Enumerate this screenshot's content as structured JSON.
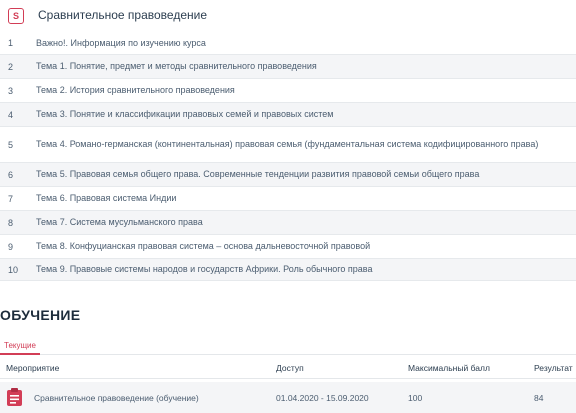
{
  "course": {
    "icon": "document-s-icon",
    "icon_letter": "S",
    "title": "Сравнительное правоведение"
  },
  "topics": [
    {
      "num": "1",
      "label": "Важно!. Информация по изучению курса"
    },
    {
      "num": "2",
      "label": "Тема 1. Понятие, предмет и методы сравнительного правоведения"
    },
    {
      "num": "3",
      "label": "Тема 2. История сравнительного правоведения"
    },
    {
      "num": "4",
      "label": "Тема 3. Понятие и классификации правовых семей и правовых систем"
    },
    {
      "num": "5",
      "label": "Тема 4. Романо-германская (континентальная) правовая семья (фундаментальная система кодифицированного права)"
    },
    {
      "num": "6",
      "label": "Тема 5. Правовая семья общего права. Современные тенденции развития правовой семьи общего права"
    },
    {
      "num": "7",
      "label": "Тема 6. Правовая система Индии"
    },
    {
      "num": "8",
      "label": "Тема 7. Система мусульманского права"
    },
    {
      "num": "9",
      "label": "Тема 8. Конфуцианская правовая система – основа дальневосточной правовой"
    },
    {
      "num": "10",
      "label": "Тема 9. Правовые системы народов и государств Африки. Роль обычного права"
    }
  ],
  "section": {
    "title": "ОБУЧЕНИЕ",
    "tab_current": "Текущие"
  },
  "events_table": {
    "columns": [
      "Мероприятие",
      "Доступ",
      "Максимальный балл",
      "Результат"
    ],
    "rows": [
      {
        "icon": "clipboard-icon",
        "name": "Сравнительное правоведение (обучение)",
        "access": "01.04.2020 - 15.09.2020",
        "max_score": "100",
        "result": "84"
      }
    ]
  },
  "colors": {
    "accent": "#d23d56",
    "row_alt": "#f4f5f7",
    "text": "#4b5d70"
  }
}
